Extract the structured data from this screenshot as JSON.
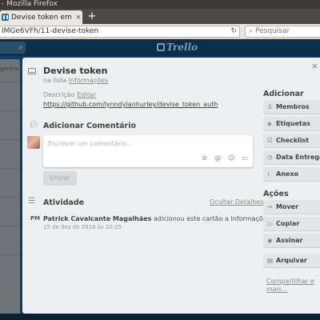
{
  "os": {
    "title": "- Mozilla Firefox"
  },
  "browser": {
    "tab_title": "Devise token em Cu…",
    "tab_close": "×",
    "new_tab": "+",
    "url": "IMGe6VFh/11-devise-token",
    "search_placeholder": "Pesquisar"
  },
  "trello": {
    "logo": "Trello",
    "list_sidebar_text": "genhara"
  },
  "card": {
    "title": "Devise token",
    "list_prefix": "na lista",
    "list_name": "Informações",
    "description_label": "Descrição",
    "edit_label": "Editar",
    "description_link": "https://github.com/lynndylanhurley/devise_token_auth",
    "close": "×"
  },
  "comment": {
    "heading": "Adicionar Comentário",
    "placeholder": "Escrever um comentário...",
    "send_label": "Enviar",
    "tools": [
      "⊘",
      "@",
      "☺",
      "▭"
    ]
  },
  "activity": {
    "heading": "Atividade",
    "hide_details": "Ocultar Detalhes",
    "avatar_initials": "PM",
    "author": "Patrick Cavalcante Magalhães",
    "action": "adicionou este cartão a Informações",
    "date": "15 de dez de 2016 às 20:25"
  },
  "sidebar": {
    "add_heading": "Adicionar",
    "add_items": [
      {
        "icon": "♙",
        "label": "Membros"
      },
      {
        "icon": "◈",
        "label": "Etiquetas"
      },
      {
        "icon": "☑",
        "label": "Checklist"
      },
      {
        "icon": "◷",
        "label": "Data Entrega"
      },
      {
        "icon": "⌇",
        "label": "Anexo"
      }
    ],
    "actions_heading": "Ações",
    "action_items": [
      {
        "icon": "→",
        "label": "Mover"
      },
      {
        "icon": "▭",
        "label": "Copiar"
      },
      {
        "icon": "◉",
        "label": "Assinar"
      },
      {
        "icon": "▤",
        "label": "Arquivar"
      }
    ],
    "share": "Compartilhar e mais..."
  }
}
